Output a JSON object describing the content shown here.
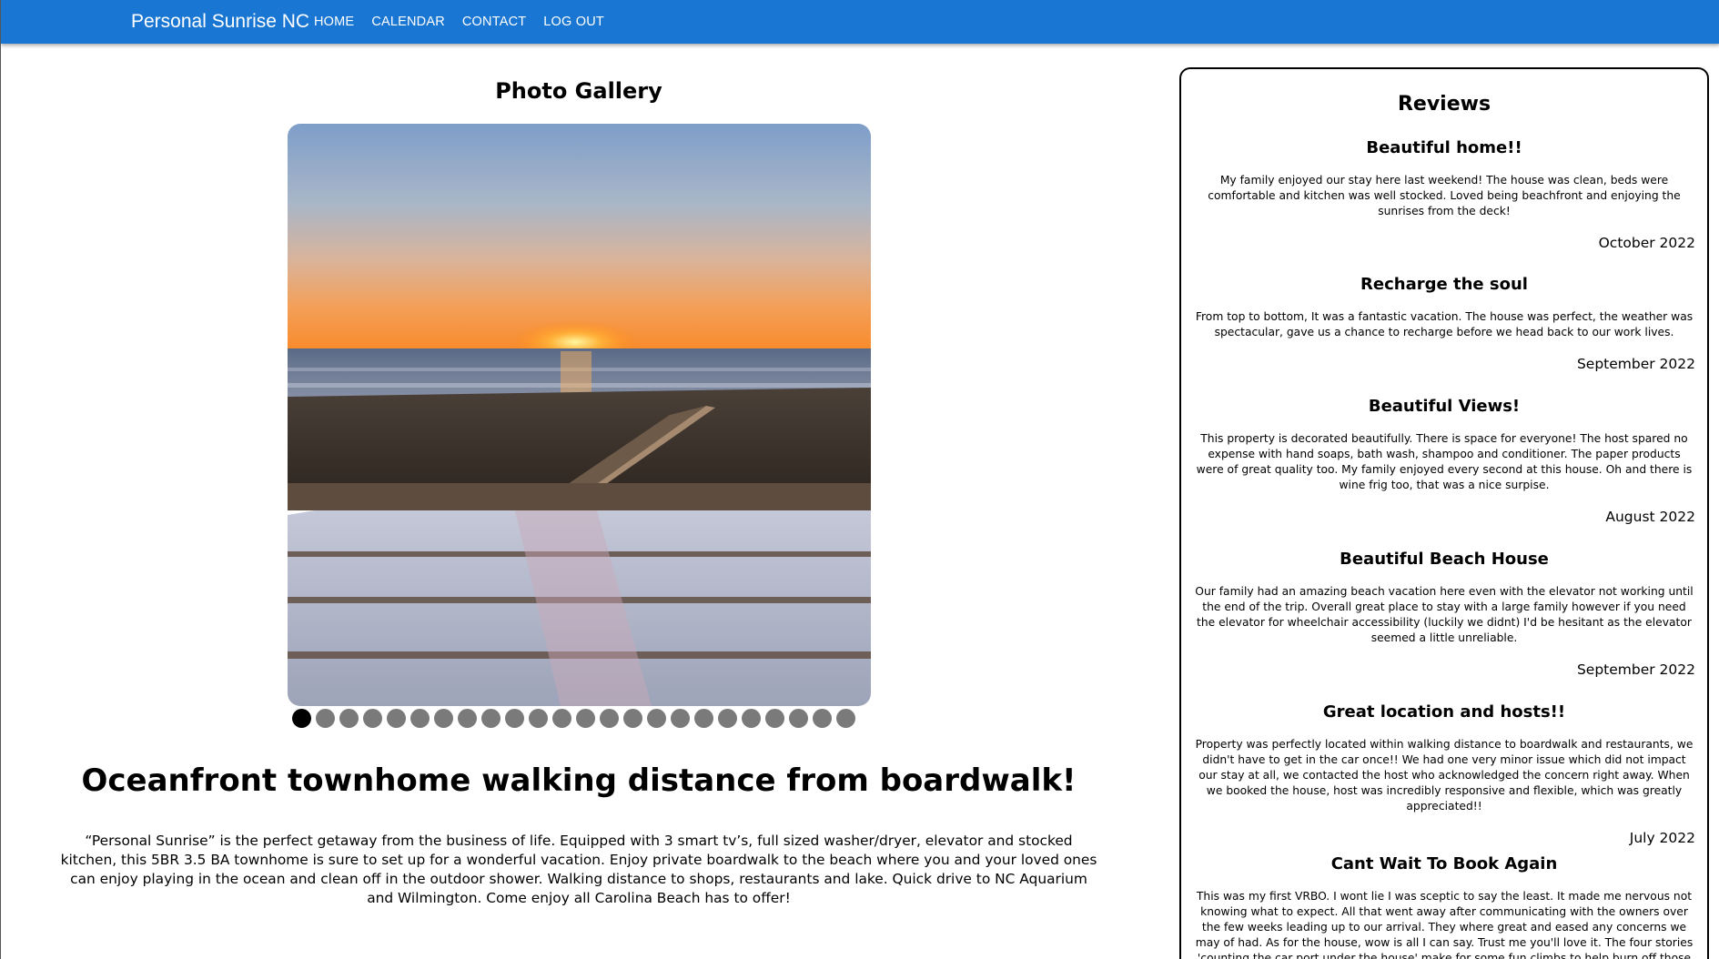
{
  "nav": {
    "brand": "Personal Sunrise NC",
    "links": [
      "HOME",
      "CALENDAR",
      "CONTACT",
      "LOG OUT"
    ]
  },
  "gallery": {
    "title": "Photo Gallery",
    "total_photos": 24,
    "active_index": 0
  },
  "listing": {
    "headline": "Oceanfront townhome walking distance from boardwalk!",
    "description": "“Personal Sunrise” is the perfect getaway from the business of life. Equipped with 3 smart tv’s, full sized washer/dryer, elevator and stocked kitchen, this 5BR 3.5 BA townhome is sure to set up for a wonderful vacation. Enjoy private boardwalk to the beach where you and your loved ones can enjoy playing in the ocean and clean off in the outdoor shower. Walking distance to shops, restaurants and lake. Quick drive to NC Aquarium and Wilmington. Come enjoy all Carolina Beach has to offer!"
  },
  "reviews": {
    "title": "Reviews",
    "items": [
      {
        "title": "Beautiful home!!",
        "text": "My family enjoyed our stay here last weekend! The house was clean, beds were comfortable and kitchen was well stocked. Loved being beachfront and enjoying the sunrises from the deck!",
        "date": "October 2022"
      },
      {
        "title": "Recharge the soul",
        "text": "From top to bottom, It was a fantastic vacation. The house was perfect, the weather was spectacular, gave us a chance to recharge before we head back to our work lives.",
        "date": "September 2022"
      },
      {
        "title": "Beautiful Views!",
        "text": "This property is decorated beautifully. There is space for everyone! The host spared no expense with hand soaps, bath wash, shampoo and conditioner. The paper products were of great quality too. My family enjoyed every second at this house. Oh and there is wine frig too, that was a nice surpise.",
        "date": "August 2022"
      },
      {
        "title": "Beautiful Beach House",
        "text": "Our family had an amazing beach vacation here even with the elevator not working until the end of the trip. Overall great place to stay with a large family however if you need the elevator for wheelchair accessibility (luckily we didnt) I'd be hesitant as the elevator seemed a little unreliable.",
        "date": "September 2022"
      },
      {
        "title": "Great location and hosts!!",
        "text": "Property was perfectly located within walking distance to boardwalk and restaurants, we didn't have to get in the car once!! We had one very minor issue which did not impact our stay at all, we contacted the host who acknowledged the concern right away. When we booked the house, host was incredibly responsive and flexible, which was greatly appreciated!!",
        "date": "July 2022"
      },
      {
        "title": "Cant Wait To Book Again",
        "text": "This was my first VRBO. I wont lie I was sceptic to say the least. It made me nervous not knowing what to expect. All that went away after communicating with the owners over the few weeks leading up to our arrival. They where great and eased any concerns we may of had. As for the house, wow is all I can say. Trust me you'll love it. The four stories 'counting the car port under the house' make for some fun climbs to help burn off those big vacation meals.",
        "date": ""
      }
    ]
  },
  "colors": {
    "navbar": "#1976d2",
    "dot_inactive": "#7a7a7a",
    "dot_active": "#000000"
  }
}
